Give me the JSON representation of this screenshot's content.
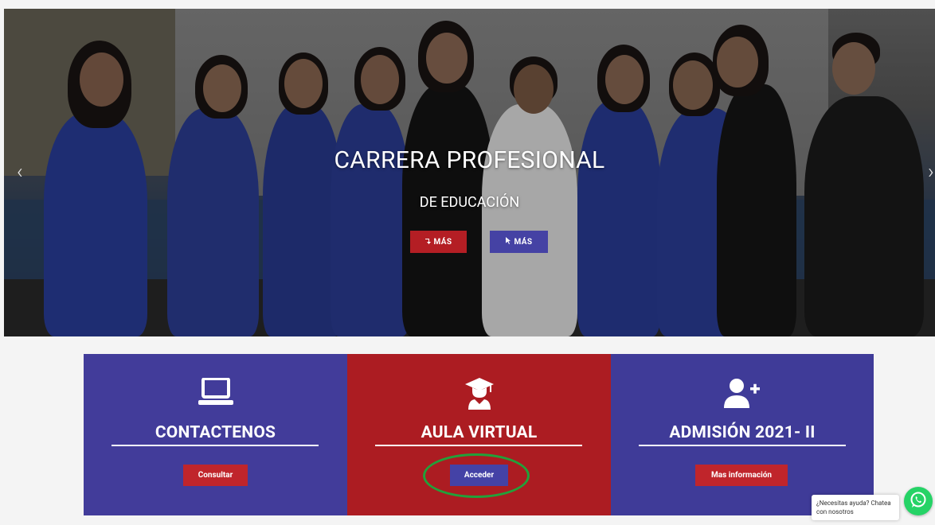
{
  "hero": {
    "title": "CARRERA PROFESIONAL",
    "subtitle": "DE EDUCACIÓN",
    "button_left": "MÁS",
    "button_right": "MÁS",
    "prev_arrow": "‹",
    "next_arrow": "›"
  },
  "cards": [
    {
      "title": "CONTACTENOS",
      "icon": "laptop-icon",
      "button": "Consultar",
      "color": "#423c9a"
    },
    {
      "title": "AULA VIRTUAL",
      "icon": "graduate-icon",
      "button": "Acceder",
      "color": "#ac1c22"
    },
    {
      "title": "ADMISIÓN 2021- II",
      "icon": "add-user-icon",
      "button": "Mas información",
      "color": "#3f3b98"
    }
  ],
  "chat": {
    "line1": "¿Necesitas ayuda? Chatea",
    "line2": "con nosotros",
    "icon": "whatsapp-icon"
  },
  "colors": {
    "brand_blue": "#423c9a",
    "brand_red": "#ac1c22",
    "highlight_green": "#22a13a",
    "whatsapp": "#25d366"
  }
}
